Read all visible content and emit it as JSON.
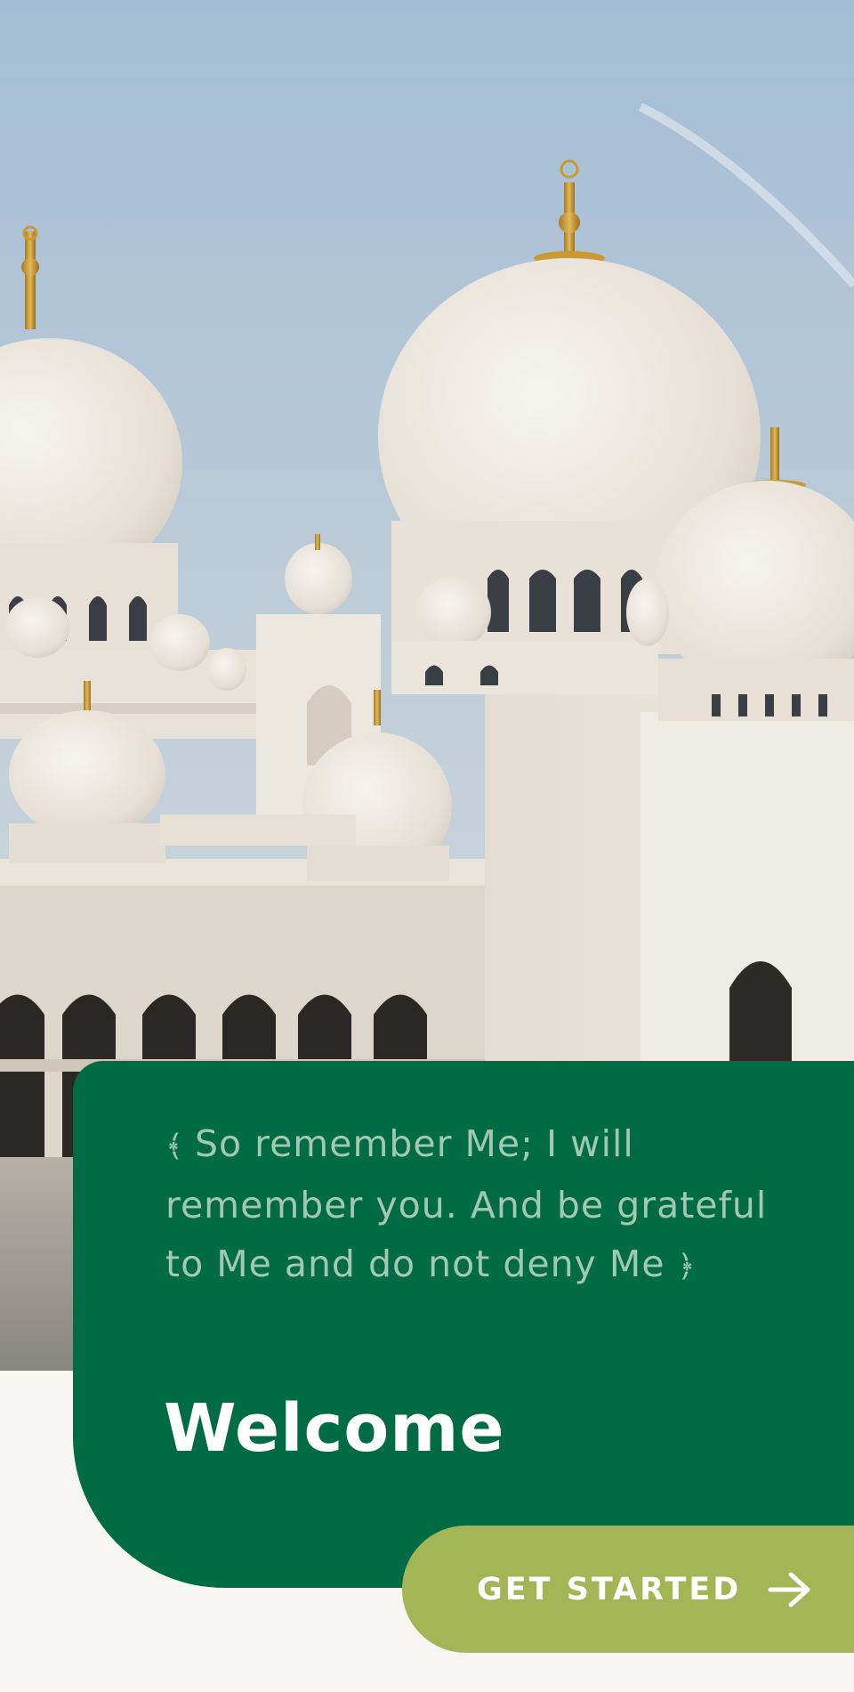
{
  "hero": {
    "image_name": "mosque-photo"
  },
  "card": {
    "quote_open": "﴾",
    "quote_text": "So remember Me; I will remember you. And be grateful to Me and do not deny Me",
    "quote_close": "﴿",
    "title": "Welcome"
  },
  "cta": {
    "label": "GET STARTED",
    "icon": "arrow-right-icon"
  },
  "colors": {
    "background": "#f8f6f3",
    "card_green": "#016b45",
    "quote_text": "#a0c8b2",
    "button_olive": "#a3b554",
    "sky": "#9fbdd6",
    "marble": "#ebe6de",
    "gold": "#c99a35"
  }
}
